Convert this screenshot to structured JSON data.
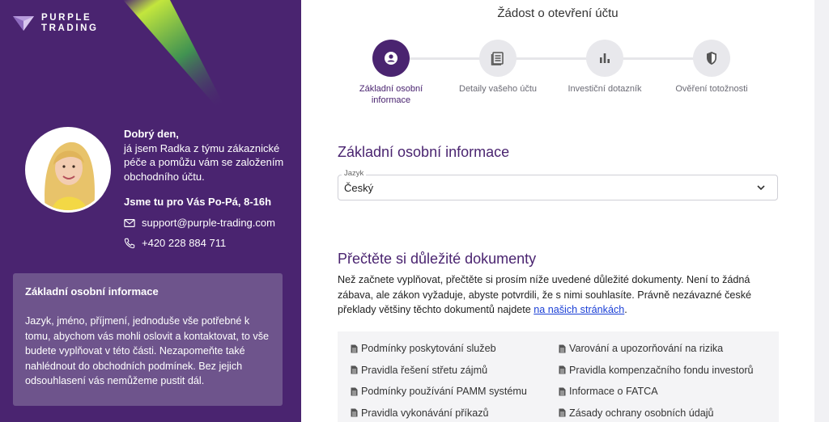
{
  "brand": {
    "line1": "PURPLE",
    "line2": "TRADING"
  },
  "agent": {
    "hello": "Dobrý den,",
    "intro": "já jsem Radka z týmu zákaznické péče a pomůžu vám se založením obchodního účtu.",
    "hours": "Jsme tu pro Vás Po-Pá, 8-16h",
    "email": "support@purple-trading.com",
    "phone": "+420 228 884 711"
  },
  "info": {
    "title": "Základní osobní informace",
    "text": "Jazyk, jméno, příjmení, jednoduše vše potřebné k tomu, abychom vás mohli oslovit a kontaktovat, to vše budete vyplňovat v této části. Nezapomeňte také nahlédnout do obchodních podmínek. Bez jejich odsouhlasení vás nemůžeme pustit dál."
  },
  "page": {
    "title": "Žádost o otevření účtu"
  },
  "steps": [
    {
      "label": "Základní osobní informace",
      "icon": "person-icon",
      "active": true
    },
    {
      "label": "Detaily vašeho účtu",
      "icon": "document-icon",
      "active": false
    },
    {
      "label": "Investiční dotazník",
      "icon": "bar-chart-icon",
      "active": false
    },
    {
      "label": "Ověření totožnosti",
      "icon": "shield-icon",
      "active": false
    }
  ],
  "section1": {
    "title": "Základní osobní informace"
  },
  "language": {
    "label": "Jazyk",
    "value": "Český"
  },
  "section2": {
    "title": "Přečtěte si důležité dokumenty",
    "text": "Než začnete vyplňovat, přečtěte si prosím níže uvedené důležité dokumenty. Není to žádná zábava, ale zákon vyžaduje, abyste potvrdili, že s nimi souhlasíte. Právně nezávazné české překlady většiny těchto dokumentů najdete ",
    "link": "na našich stránkách",
    "tail": "."
  },
  "documents": [
    "Podmínky poskytování služeb",
    "Varování a upozorňování na rizika",
    "Pravidla řešení střetu zájmů",
    "Pravidla kompenzačního fondu investorů",
    "Podmínky používání PAMM systému",
    "Informace o FATCA",
    "Pravidla vykonávání příkazů",
    "Zásady ochrany osobních údajů"
  ],
  "colors": {
    "brand": "#4a2470",
    "infobox": "#6e548c",
    "link": "#1a3fd6"
  }
}
